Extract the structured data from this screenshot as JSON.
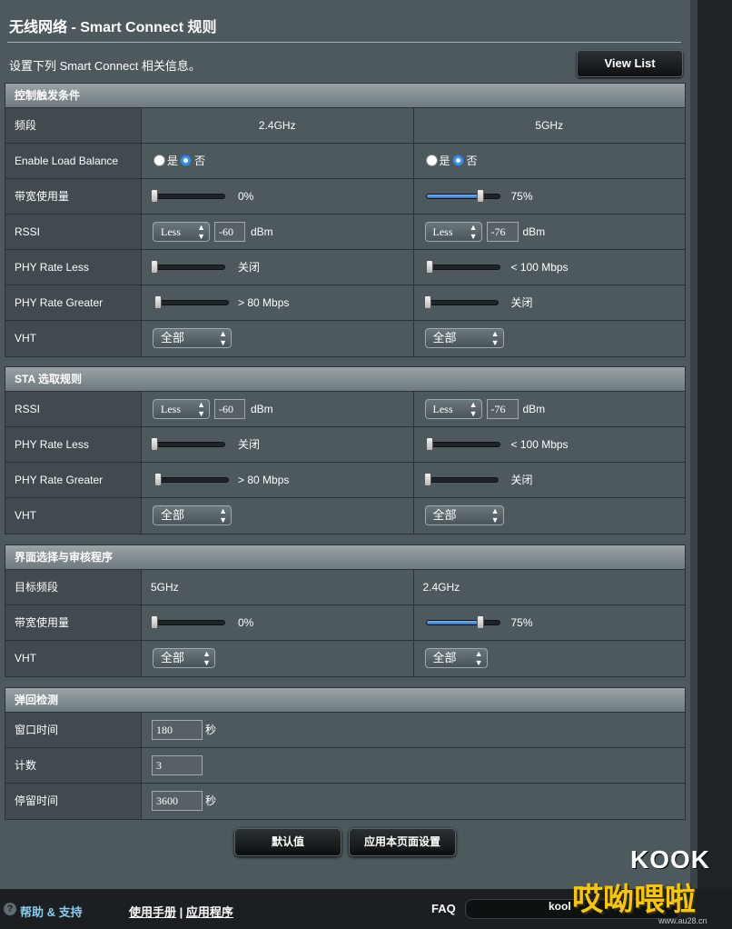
{
  "page": {
    "title": "无线网络 - Smart Connect 规则",
    "subtitle": "设置下列 Smart Connect 相关信息。",
    "view_list_label": "View List"
  },
  "control": {
    "header": "控制触发条件",
    "band_label": "频段",
    "band_24": "2.4GHz",
    "band_5": "5GHz",
    "load_balance_label": "Enable Load Balance",
    "yes": "是",
    "no": "否",
    "lb_24_selected": "否",
    "lb_5_selected": "否",
    "bw_label": "带宽使用量",
    "bw_24_value": "0%",
    "bw_24_level": 0,
    "bw_5_value": "75%",
    "bw_5_level": 0.75,
    "rssi_label": "RSSI",
    "rssi_24_op": "Less",
    "rssi_24_val": "-60",
    "rssi_5_op": "Less",
    "rssi_5_val": "-76",
    "dbm": "dBm",
    "phy_less_label": "PHY Rate Less",
    "phy_less_24": "关闭",
    "phy_less_5": "< 100 Mbps",
    "phy_greater_label": "PHY Rate Greater",
    "phy_greater_24": "> 80 Mbps",
    "phy_greater_5": "关闭",
    "vht_label": "VHT",
    "vht_24": "全部",
    "vht_5": "全部"
  },
  "sta": {
    "header": "STA 选取规则",
    "rssi_label": "RSSI",
    "rssi_24_op": "Less",
    "rssi_24_val": "-60",
    "rssi_5_op": "Less",
    "rssi_5_val": "-76",
    "dbm": "dBm",
    "phy_less_label": "PHY Rate Less",
    "phy_less_24": "关闭",
    "phy_less_5": "< 100 Mbps",
    "phy_greater_label": "PHY Rate Greater",
    "phy_greater_24": "> 80 Mbps",
    "phy_greater_5": "关闭",
    "vht_label": "VHT",
    "vht_24": "全部",
    "vht_5": "全部"
  },
  "steer": {
    "header": "界面选择与审核程序",
    "target_label": "目标频段",
    "target_24": "5GHz",
    "target_5": "2.4GHz",
    "bw_label": "带宽使用量",
    "bw_24_value": "0%",
    "bw_24_level": 0,
    "bw_5_value": "75%",
    "bw_5_level": 0.75,
    "vht_label": "VHT",
    "vht_24": "全部",
    "vht_5": "全部"
  },
  "bounce": {
    "header": "弹回检测",
    "window_label": "窗口时间",
    "window_value": "180",
    "window_unit": "秒",
    "count_label": "计数",
    "count_value": "3",
    "dwell_label": "停留时间",
    "dwell_value": "3600",
    "dwell_unit": "秒"
  },
  "buttons": {
    "default": "默认值",
    "apply": "应用本页面设置"
  },
  "footer": {
    "help": "帮助 & 支持",
    "manual": "使用手册",
    "separator": "|",
    "apps": "应用程序",
    "faq": "FAQ"
  },
  "watermark": {
    "line1": "KOOK",
    "line2": "哎呦喂啦",
    "url": "www.au28.cn",
    "kool": "kool"
  },
  "colors": {
    "background": "#4d595d",
    "label_column": "#414a4e",
    "section_header": "#808b8f",
    "slider_fill": "#3f8ed9",
    "help_link": "#8ecbf0",
    "watermark_yellow": "#f3c516"
  }
}
